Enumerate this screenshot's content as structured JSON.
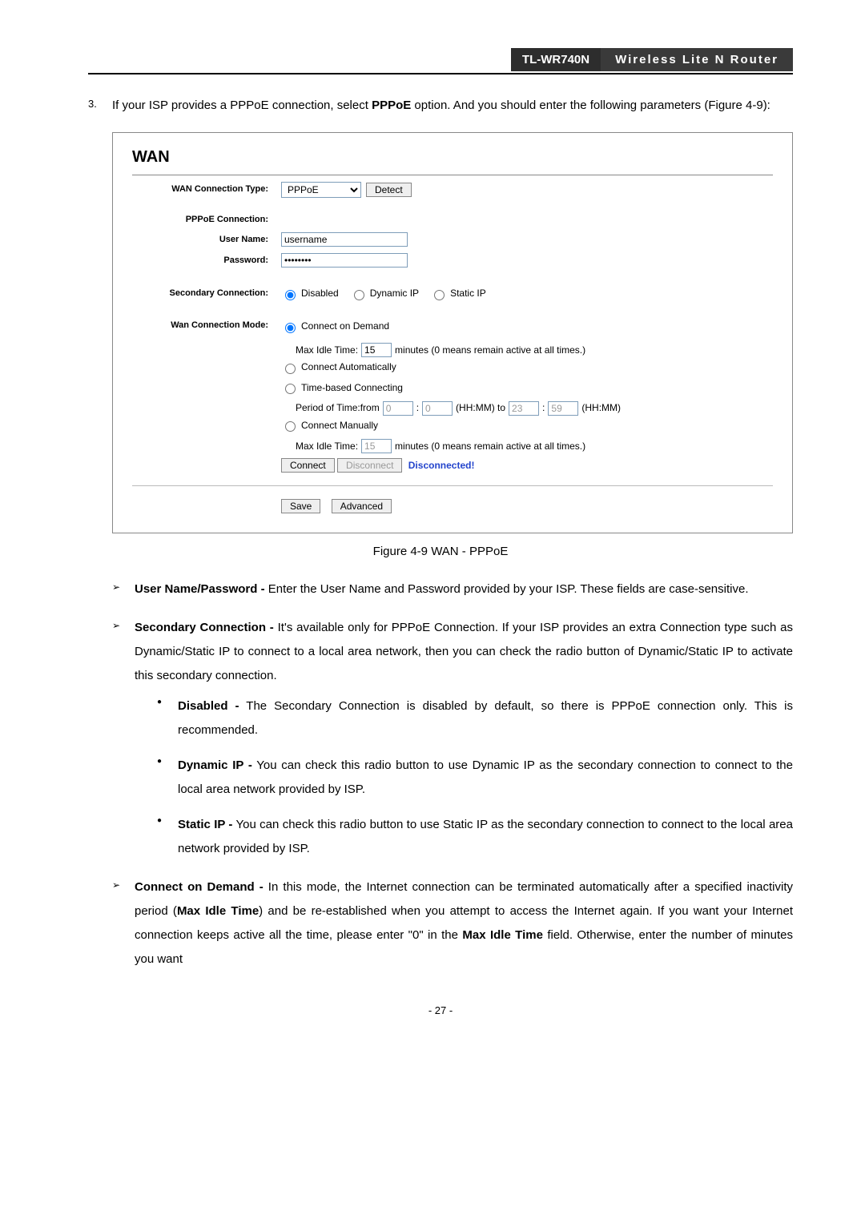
{
  "header": {
    "model": "TL-WR740N",
    "title": "Wireless Lite N Router"
  },
  "step": {
    "num": "3.",
    "text_before": "If your ISP provides a PPPoE connection, select ",
    "bold": "PPPoE",
    "text_after": " option. And you should enter the following parameters (Figure 4-9):"
  },
  "wan": {
    "heading": "WAN",
    "labels": {
      "conn_type": "WAN Connection Type:",
      "pppoe_conn": "PPPoE Connection:",
      "user": "User Name:",
      "pass": "Password:",
      "secondary": "Secondary Connection:",
      "mode": "Wan Connection Mode:"
    },
    "conn_type_value": "PPPoE",
    "detect_btn": "Detect",
    "user_value": "username",
    "pass_value": "••••••••",
    "secondary_opts": {
      "disabled": "Disabled",
      "dynamic": "Dynamic IP",
      "static": "Static IP"
    },
    "mode_opts": {
      "demand": "Connect on Demand",
      "auto": "Connect Automatically",
      "time": "Time-based Connecting",
      "manual": "Connect Manually"
    },
    "idle_label": "Max Idle Time:",
    "idle_value": "15",
    "idle_unit": "minutes (0 means remain active at all times.)",
    "period_label": "Period of Time:from",
    "period_from_h": "0",
    "period_from_m": "0",
    "period_mid": "(HH:MM) to",
    "period_to_h": "23",
    "period_to_m": "59",
    "period_end": "(HH:MM)",
    "connect_btn": "Connect",
    "disconnect_btn": "Disconnect",
    "status": "Disconnected!",
    "save_btn": "Save",
    "advanced_btn": "Advanced"
  },
  "caption": "Figure 4-9    WAN - PPPoE",
  "bullets": {
    "b1_bold": "User Name/Password -",
    "b1": " Enter the User Name and Password provided by your ISP. These fields are case-sensitive.",
    "b2_bold": "Secondary Connection -",
    "b2": " It's available only for PPPoE Connection. If your ISP provides an extra Connection type such as Dynamic/Static IP to connect to a local area network, then you can check the radio button of Dynamic/Static IP to activate this secondary connection.",
    "s1_bold": "Disabled -",
    "s1": " The Secondary Connection is disabled by default, so there is PPPoE connection only. This is recommended.",
    "s2_bold": "Dynamic IP -",
    "s2": " You can check this radio button to use Dynamic IP as the secondary connection to connect to the local area network provided by ISP.",
    "s3_bold": "Static IP -",
    "s3": " You can check this radio button to use Static IP as the secondary connection to connect to the local area network provided by ISP.",
    "b3_bold": "Connect on Demand -",
    "b3a": " In this mode, the Internet connection can be terminated automatically after a specified inactivity period (",
    "b3b_bold": "Max Idle Time",
    "b3c": ") and be re-established when you attempt to access the Internet again. If you want your Internet connection keeps active all the time, please enter \"0\" in the ",
    "b3d_bold": "Max Idle Time",
    "b3e": " field. Otherwise, enter the number of minutes you want"
  },
  "page": "- 27 -"
}
